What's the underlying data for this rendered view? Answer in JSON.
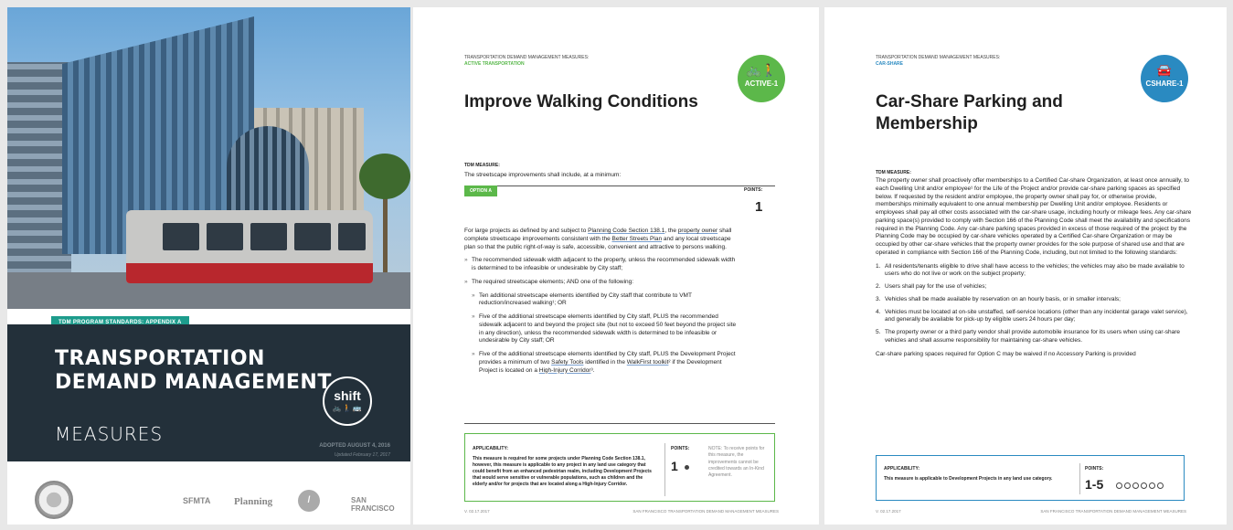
{
  "cover": {
    "strip": "TDM PROGRAM STANDARDS: APPENDIX A",
    "title_line1": "TRANSPORTATION",
    "title_line2": "DEMAND MANAGEMENT",
    "title_line3": "MEASURES",
    "shift_word": "shift",
    "shift_icons": "🚲🚶🚌",
    "adopted": "ADOPTED AUGUST 4, 2016",
    "updated": "Updated February 17, 2017",
    "logos": {
      "sfmta": "SFMTA",
      "planning": "Planning",
      "sf": "SAN FRANCISCO"
    }
  },
  "page2": {
    "category": "TRANSPORTATION DEMAND MANAGEMENT MEASURES:",
    "subcategory": "ACTIVE TRANSPORTATION",
    "title": "Improve Walking Conditions",
    "badge_icon": "🚲🚶",
    "badge_label": "ACTIVE-1",
    "measure_label": "TDM MEASURE:",
    "intro": "The streetscape improvements shall include, at a minimum:",
    "option_label": "OPTION A",
    "points_label": "POINTS:",
    "points_value": "1",
    "para1_a": "For large projects as defined by and subject to ",
    "para1_link1": "Planning Code Section 138.1",
    "para1_b": ", the ",
    "para1_link2": "property owner",
    "para1_c": " shall complete streetscape improvements consistent with the ",
    "para1_link3": "Better Streets Plan",
    "para1_d": " and any local streetscape plan so that the public right-of-way is safe, accessible, convenient and attractive to persons walking.",
    "bullet1": "The recommended sidewalk width adjacent to the property, unless the recommended sidewalk width is determined to be infeasible or undesirable by City staff;",
    "bullet2": "The required streetscape elements; AND one of the following:",
    "sub1": "Ten additional streetscape elements identified by City staff that contribute to VMT reduction/increased walking¹; OR",
    "sub2": "Five of the additional streetscape elements identified by City staff, PLUS the recommended sidewalk adjacent to and beyond the project site (but not to exceed 50 feet beyond the project site in any direction), unless the recommended sidewalk width is determined to be infeasible or undesirable by City staff; OR",
    "sub3_a": "Five of the additional streetscape elements identified by City staff, PLUS the Development Project provides a minimum of two ",
    "sub3_link1": "Safety Tools",
    "sub3_b": " identified in the ",
    "sub3_link2": "WalkFirst toolkit",
    "sub3_c": "² if the Development Project is located on a ",
    "sub3_link3": "High-Injury Corridor",
    "sub3_d": "³.",
    "applicability_label": "APPLICABILITY:",
    "applicability_text": "This measure is required for some projects under Planning Code Section 138.1, however, this measure is applicable to any project in any land use category that could benefit from an enhanced pedestrian realm, including Development Projects that would serve sensitive or vulnerable populations, such as children and the elderly and/or for projects that are located along a High-Injury Corridor.",
    "app_points_label": "POINTS:",
    "app_points_value": "1",
    "note": "NOTE: To receive points for this measure, the improvements cannot be credited towards an In-Kind Agreement.",
    "footer_left": "V. 02.17.2017",
    "footer_right": "SAN FRANCISCO TRANSPORTATION DEMAND MANAGEMENT MEASURES"
  },
  "page3": {
    "category": "TRANSPORTATION DEMAND MANAGEMENT MEASURES:",
    "subcategory": "CAR-SHARE",
    "title_line1": "Car-Share Parking and",
    "title_line2": "Membership",
    "badge_icon": "🚘",
    "badge_label": "CSHARE-1",
    "measure_label": "TDM MEASURE:",
    "para1": "The property owner shall proactively offer memberships to a Certified Car-share Organization, at least once annually, to each Dwelling Unit and/or employee¹ for the Life of the Project and/or provide car-share parking spaces as specified below. If requested by the resident and/or employee, the property owner shall pay for, or otherwise provide, memberships minimally equivalent to one annual membership per Dwelling Unit and/or employee. Residents or employees shall pay all other costs associated with the car-share usage, including hourly or mileage fees. Any car-share parking space(s) provided to comply with Section 166 of the Planning Code shall meet the availability and specifications required in the Planning Code. Any car-share parking spaces provided in excess of those required of the project by the Planning Code may be occupied by car-share vehicles operated by a Certified Car-share Organization or may be occupied by other car-share vehicles that the property owner provides for the sole purpose of shared use and that are operated in compliance with Section 166 of the Planning Code, including, but not limited to the following standards:",
    "items": [
      "All residents/tenants eligible to drive shall have access to the vehicles; the vehicles may also be made available to users who do not live or work on the subject property;",
      "Users shall pay for the use of vehicles;",
      "Vehicles shall be made available by reservation on an hourly basis, or in smaller intervals;",
      "Vehicles must be located at on-site unstaffed, self-service locations (other than any incidental garage valet service), and generally be available for pick-up by eligible users 24 hours per day;",
      "The property owner or a third party vendor shall provide automobile insurance for its users when using car-share vehicles and shall assume responsibility for maintaining car-share vehicles."
    ],
    "para2": "Car-share parking spaces required for Option C may be waived if no Accessory Parking is provided",
    "applicability_label": "APPLICABILITY:",
    "applicability_text": "This measure is applicable to Development Projects in any land use category.",
    "app_points_label": "POINTS:",
    "app_points_value": "1-5",
    "footer_left": "V. 02.17.2017",
    "footer_right": "SAN FRANCISCO TRANSPORTATION DEMAND MANAGEMENT MEASURES"
  }
}
